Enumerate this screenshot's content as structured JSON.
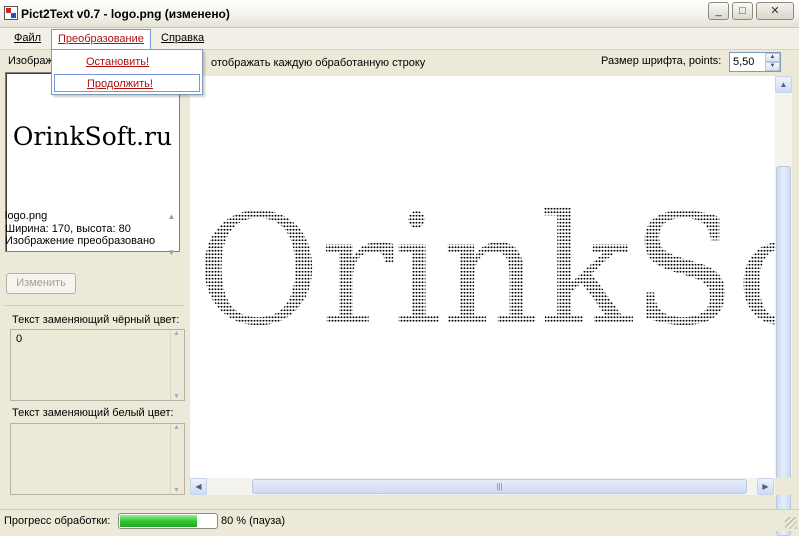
{
  "window": {
    "title": "Pict2Text v0.7 - logo.png (изменено)",
    "minimize_glyph": "_",
    "maximize_glyph": "□",
    "close_glyph": "✕"
  },
  "menu": {
    "file": "Файл",
    "transform": "Преобразование",
    "help": "Справка",
    "transform_items": [
      "Остановить!",
      "Продолжить!"
    ]
  },
  "left": {
    "image_label": "Изображение",
    "preview_text": "OrinkSoft.ru",
    "info": {
      "filename": "logo.png",
      "dimensions": "Ширина: 170, высота: 80",
      "status": "Изображение преобразовано"
    },
    "change_button": "Изменить",
    "black_label": "Текст заменяющий чёрный цвет:",
    "black_value": "0",
    "white_label": "Текст заменяющий белый цвет:",
    "white_value": ""
  },
  "options": {
    "show_each_line_label": "отображать каждую обработанную строку",
    "font_size_label": "Размер шрифта, points:",
    "font_size_value": "5,50"
  },
  "canvas": {
    "ascii_text": "OrinkSoft.ru"
  },
  "status": {
    "progress_label": "Прогресс обработки:",
    "progress_fraction": 0.8,
    "progress_text": "80 % (пауза)",
    "progress_color": "#2ec22e"
  },
  "icons": {
    "scroll_up": "▲",
    "scroll_down": "▼",
    "scroll_left": "◀",
    "scroll_right": "▶",
    "thumb_grip": "|||"
  }
}
